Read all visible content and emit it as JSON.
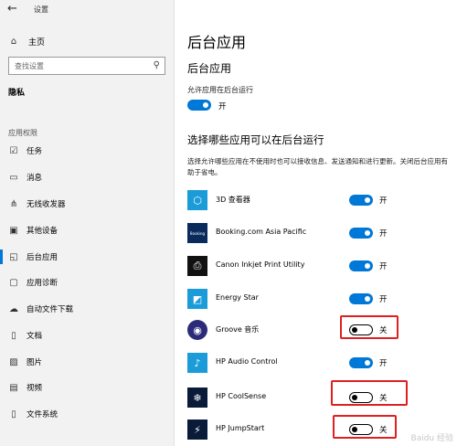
{
  "window": {
    "title": "设置"
  },
  "sidebar": {
    "home_label": "主页",
    "search_placeholder": "查找设置",
    "privacy_title": "隐私",
    "section_label": "应用权限",
    "items": [
      {
        "label": "任务",
        "icon": "task-icon"
      },
      {
        "label": "消息",
        "icon": "message-icon"
      },
      {
        "label": "无线收发器",
        "icon": "radio-icon"
      },
      {
        "label": "其他设备",
        "icon": "device-icon"
      },
      {
        "label": "后台应用",
        "icon": "background-apps-icon",
        "active": true
      },
      {
        "label": "应用诊断",
        "icon": "diagnostics-icon"
      },
      {
        "label": "自动文件下载",
        "icon": "cloud-icon"
      },
      {
        "label": "文档",
        "icon": "document-icon"
      },
      {
        "label": "图片",
        "icon": "picture-icon"
      },
      {
        "label": "视频",
        "icon": "video-icon"
      },
      {
        "label": "文件系统",
        "icon": "file-system-icon"
      }
    ]
  },
  "main": {
    "title": "后台应用",
    "section1_heading": "后台应用",
    "allow_label": "允许应用在后台运行",
    "allow_toggle": {
      "state": "开",
      "on": true
    },
    "section2_heading": "选择哪些应用可以在后台运行",
    "description": "选择允许哪些应用在不使用时也可以接收信息、发送通知和进行更新。关闭后台应用有助于省电。",
    "apps": [
      {
        "name": "3D 查看器",
        "state": "开",
        "on": true,
        "icon_color": "#1b9cd8"
      },
      {
        "name": "Booking.com Asia Pacific",
        "state": "开",
        "on": true,
        "icon_color": "#0a2a5c",
        "icon_text": "Booking"
      },
      {
        "name": "Canon Inkjet Print Utility",
        "state": "开",
        "on": true,
        "icon_color": "#111111"
      },
      {
        "name": "Energy Star",
        "state": "开",
        "on": true,
        "icon_color": "#1b9cd8"
      },
      {
        "name": "Groove 音乐",
        "state": "关",
        "on": false,
        "icon_color": "#2b2b7a"
      },
      {
        "name": "HP Audio Control",
        "state": "开",
        "on": true,
        "icon_color": "#1b9cd8"
      },
      {
        "name": "HP CoolSense",
        "state": "关",
        "on": false,
        "icon_color": "#0a1b3a"
      },
      {
        "name": "HP JumpStart",
        "state": "关",
        "on": false,
        "icon_color": "#0a1b3a"
      }
    ]
  },
  "watermark": "Baidu 经验",
  "colors": {
    "accent": "#0078d7",
    "highlight": "#e02020"
  }
}
